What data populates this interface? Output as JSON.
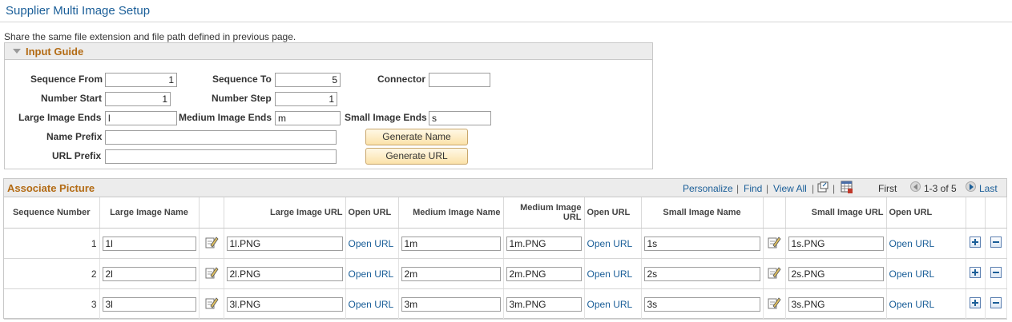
{
  "page": {
    "title": "Supplier Multi Image Setup",
    "intro": "Share the same file extension and file path defined in previous page."
  },
  "input_guide": {
    "title": "Input Guide",
    "sequence_from_label": "Sequence From",
    "sequence_from_value": "1",
    "sequence_to_label": "Sequence To",
    "sequence_to_value": "5",
    "connector_label": "Connector",
    "connector_value": "",
    "number_start_label": "Number Start",
    "number_start_value": "1",
    "number_step_label": "Number Step",
    "number_step_value": "1",
    "large_ends_label": "Large Image Ends",
    "large_ends_value": "l",
    "medium_ends_label": "Medium Image Ends",
    "medium_ends_value": "m",
    "small_ends_label": "Small Image Ends",
    "small_ends_value": "s",
    "name_prefix_label": "Name Prefix",
    "name_prefix_value": "",
    "url_prefix_label": "URL Prefix",
    "url_prefix_value": "",
    "generate_name_label": "Generate Name",
    "generate_url_label": "Generate URL"
  },
  "grid": {
    "title": "Associate Picture",
    "personalize": "Personalize",
    "find": "Find",
    "view_all": "View All",
    "first": "First",
    "range": "1-3 of 5",
    "last": "Last",
    "columns": {
      "seq": "Sequence Number",
      "large_name": "Large Image Name",
      "large_url": "Large Image URL",
      "open_url_1": "Open URL",
      "medium_name": "Medium Image Name",
      "medium_url": "Medium Image URL",
      "open_url_2": "Open URL",
      "small_name": "Small Image Name",
      "small_url": "Small Image URL",
      "open_url_3": "Open URL"
    },
    "rows": [
      {
        "seq": "1",
        "large_name": "1l",
        "large_url": "1l.PNG",
        "open1": "Open URL",
        "medium_name": "1m",
        "medium_url": "1m.PNG",
        "open2": "Open URL",
        "small_name": "1s",
        "small_url": "1s.PNG",
        "open3": "Open URL"
      },
      {
        "seq": "2",
        "large_name": "2l",
        "large_url": "2l.PNG",
        "open1": "Open URL",
        "medium_name": "2m",
        "medium_url": "2m.PNG",
        "open2": "Open URL",
        "small_name": "2s",
        "small_url": "2s.PNG",
        "open3": "Open URL"
      },
      {
        "seq": "3",
        "large_name": "3l",
        "large_url": "3l.PNG",
        "open1": "Open URL",
        "medium_name": "3m",
        "medium_url": "3m.PNG",
        "open2": "Open URL",
        "small_name": "3s",
        "small_url": "3s.PNG",
        "open3": "Open URL"
      }
    ]
  },
  "colors": {
    "link": "#1a5e98",
    "section_title": "#b36b14",
    "button_face": "#fbe2a9"
  }
}
